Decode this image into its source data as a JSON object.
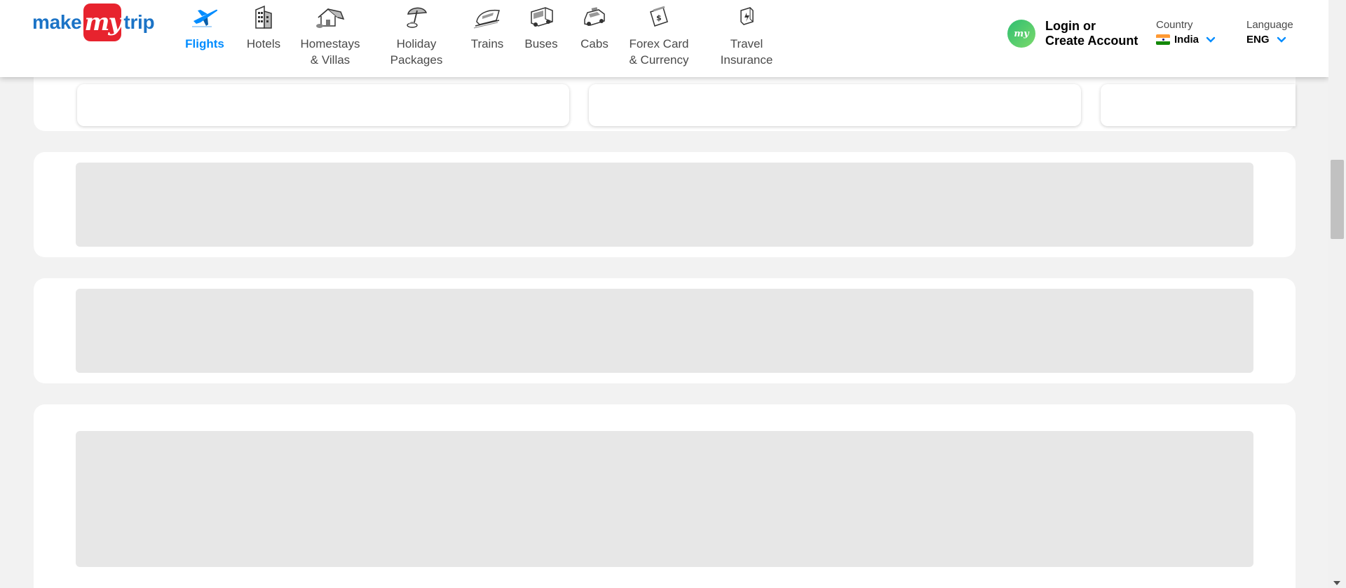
{
  "logo": {
    "left": "make",
    "mid": "my",
    "right": "trip"
  },
  "nav": [
    {
      "label": "Flights",
      "icon": "flight-icon",
      "active": true
    },
    {
      "label": "Hotels",
      "icon": "hotel-icon"
    },
    {
      "label": "Homestays\n& Villas",
      "icon": "homestay-icon"
    },
    {
      "label": "Holiday\nPackages",
      "icon": "holiday-package-icon"
    },
    {
      "label": "Trains",
      "icon": "train-icon"
    },
    {
      "label": "Buses",
      "icon": "bus-icon"
    },
    {
      "label": "Cabs",
      "icon": "cab-icon"
    },
    {
      "label": "Forex Card\n& Currency",
      "icon": "forex-icon"
    },
    {
      "label": "Travel\nInsurance",
      "icon": "insurance-icon"
    }
  ],
  "login": {
    "avatar_text": "my",
    "label": "Login or\nCreate Account"
  },
  "country": {
    "label": "Country",
    "value": "India"
  },
  "language": {
    "label": "Language",
    "value": "ENG"
  },
  "colors": {
    "accent": "#008cff",
    "brand_blue": "#1b73c6",
    "brand_red": "#e7232e",
    "skeleton": "#e7e7e7",
    "page_bg": "#f2f2f2"
  }
}
